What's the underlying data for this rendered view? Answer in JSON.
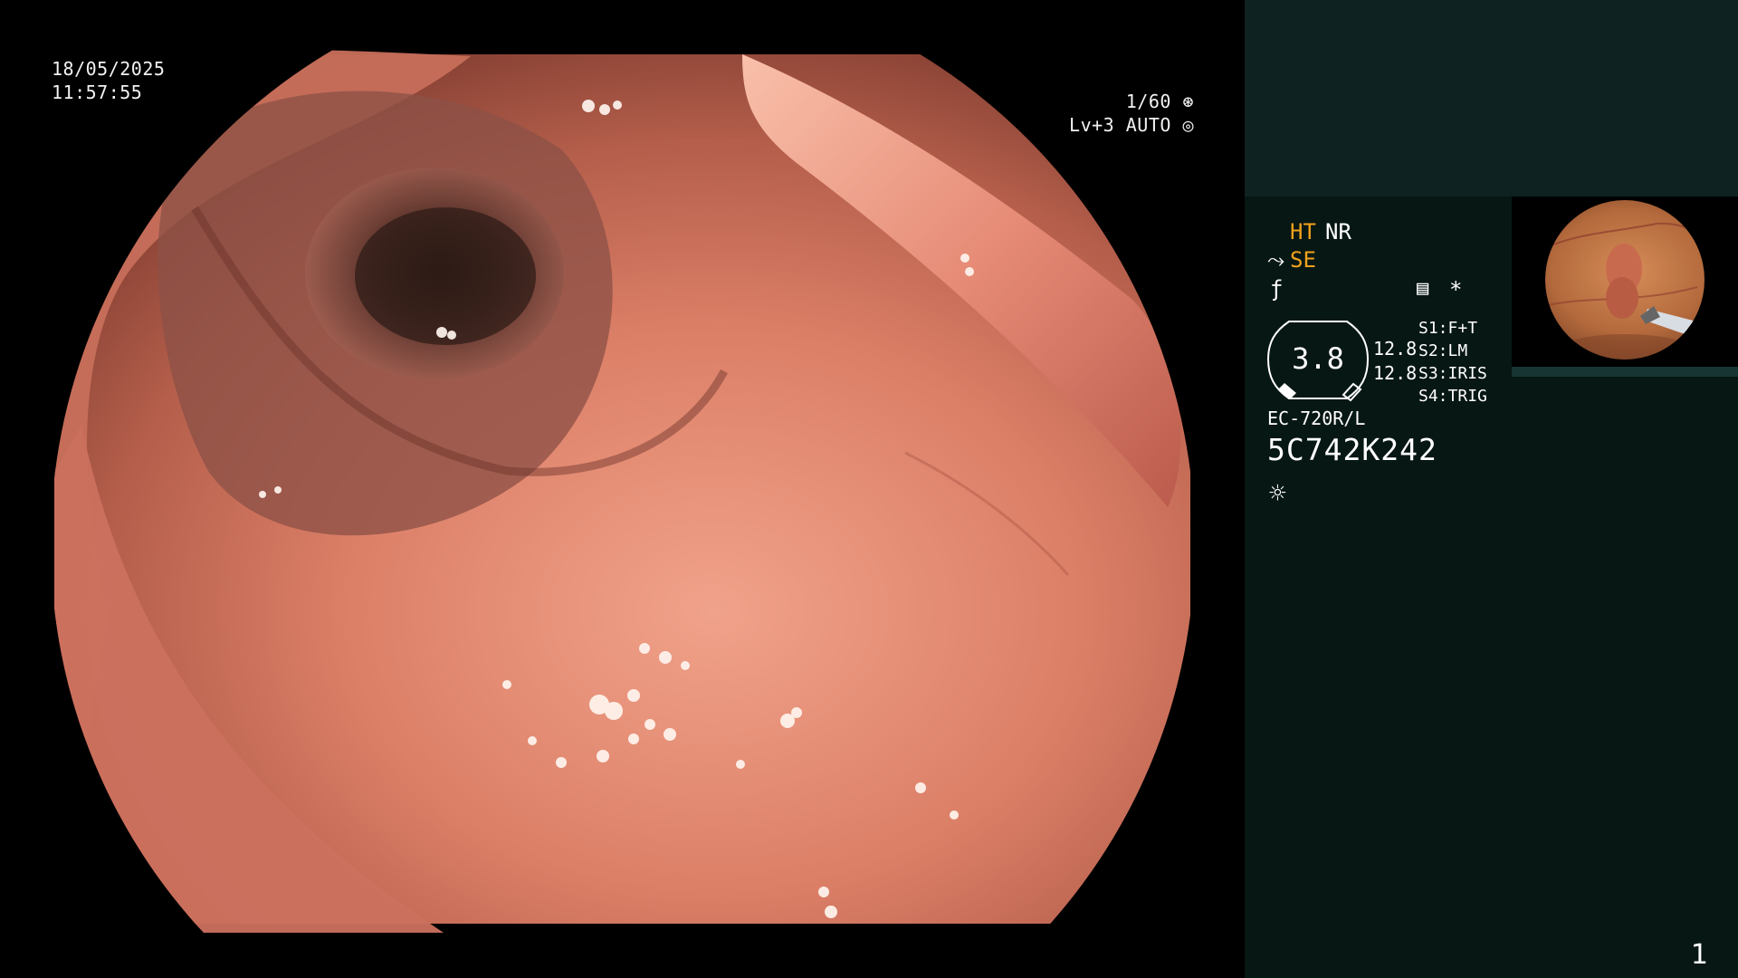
{
  "osd": {
    "date": "18/05/2025",
    "time": "11:57:55",
    "shutter": "1/60",
    "level": "Lv+3 AUTO"
  },
  "panel": {
    "ht": "HT",
    "nr": "NR",
    "se": "SE",
    "dial_value": "3.8",
    "left_values": [
      "12.8",
      "12.8"
    ],
    "switches": [
      {
        "key": "S1:",
        "value": "F+T"
      },
      {
        "key": "S2:",
        "value": "LM"
      },
      {
        "key": "S3:",
        "value": "IRIS"
      },
      {
        "key": "S4:",
        "value": "TRIG"
      }
    ],
    "scope_model": "EC-720R/L",
    "serial": "5C742K242",
    "asterisk": "*",
    "page": "1"
  },
  "colors": {
    "accent": "#f0a21c",
    "panel_bg": "#071714",
    "panel_top_bg": "#0e2221"
  },
  "icons": [
    "shutter-icon",
    "auto-iris-icon",
    "scope-icon",
    "function-icon",
    "memo-icon",
    "light-icon"
  ]
}
